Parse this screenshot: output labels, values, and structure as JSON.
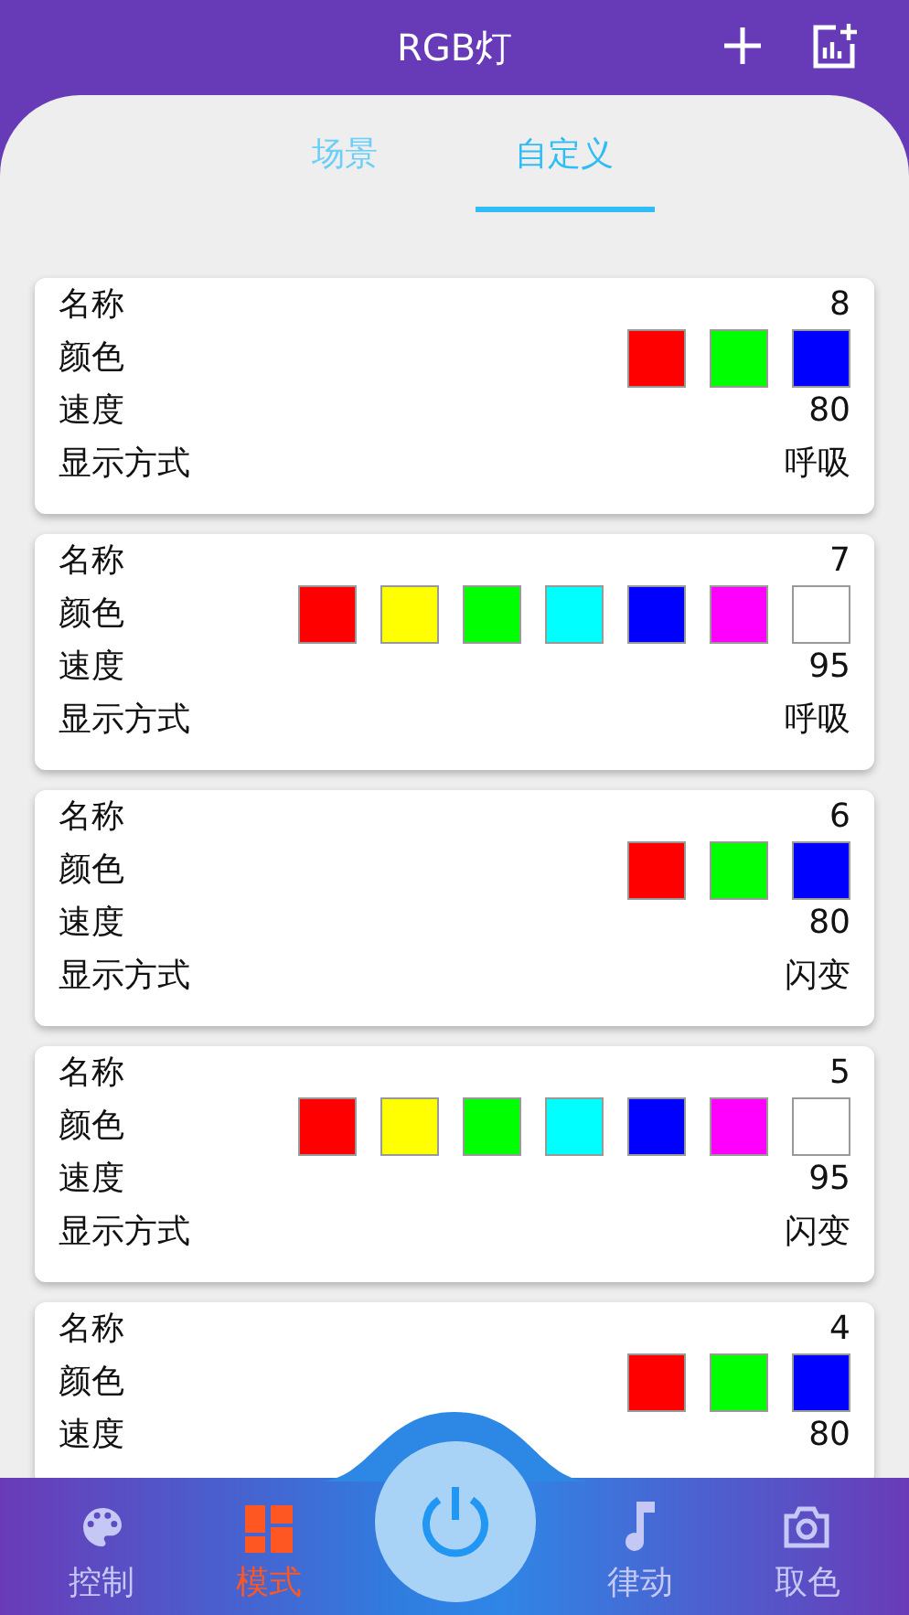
{
  "header": {
    "title": "RGB灯"
  },
  "tabs": [
    {
      "label": "场景",
      "selected": false
    },
    {
      "label": "自定义",
      "selected": true
    }
  ],
  "cards": [
    {
      "fields": [
        {
          "kind": "text",
          "label": "名称",
          "value": "8"
        },
        {
          "kind": "colors",
          "label": "颜色",
          "colors": [
            {
              "color": "#ff0000"
            },
            {
              "color": "#00ff00"
            },
            {
              "color": "#0000ff"
            }
          ]
        },
        {
          "kind": "text",
          "label": "速度",
          "value": "80"
        },
        {
          "kind": "text",
          "label": "显示方式",
          "value": "呼吸"
        }
      ]
    },
    {
      "fields": [
        {
          "kind": "text",
          "label": "名称",
          "value": "7"
        },
        {
          "kind": "colors",
          "label": "颜色",
          "colors": [
            {
              "color": "#ff0000"
            },
            {
              "color": "#ffff00"
            },
            {
              "color": "#00ff00"
            },
            {
              "color": "#00ffff"
            },
            {
              "color": "#0000ff"
            },
            {
              "color": "#ff00ff"
            },
            {
              "color": "#ffffff"
            }
          ]
        },
        {
          "kind": "text",
          "label": "速度",
          "value": "95"
        },
        {
          "kind": "text",
          "label": "显示方式",
          "value": "呼吸"
        }
      ]
    },
    {
      "fields": [
        {
          "kind": "text",
          "label": "名称",
          "value": "6"
        },
        {
          "kind": "colors",
          "label": "颜色",
          "colors": [
            {
              "color": "#ff0000"
            },
            {
              "color": "#00ff00"
            },
            {
              "color": "#0000ff"
            }
          ]
        },
        {
          "kind": "text",
          "label": "速度",
          "value": "80"
        },
        {
          "kind": "text",
          "label": "显示方式",
          "value": "闪变"
        }
      ]
    },
    {
      "fields": [
        {
          "kind": "text",
          "label": "名称",
          "value": "5"
        },
        {
          "kind": "colors",
          "label": "颜色",
          "colors": [
            {
              "color": "#ff0000"
            },
            {
              "color": "#ffff00"
            },
            {
              "color": "#00ff00"
            },
            {
              "color": "#00ffff"
            },
            {
              "color": "#0000ff"
            },
            {
              "color": "#ff00ff"
            },
            {
              "color": "#ffffff"
            }
          ]
        },
        {
          "kind": "text",
          "label": "速度",
          "value": "95"
        },
        {
          "kind": "text",
          "label": "显示方式",
          "value": "闪变"
        }
      ]
    },
    {
      "fields": [
        {
          "kind": "text",
          "label": "名称",
          "value": "4"
        },
        {
          "kind": "colors",
          "label": "颜色",
          "colors": [
            {
              "color": "#ff0000"
            },
            {
              "color": "#00ff00"
            },
            {
              "color": "#0000ff"
            }
          ]
        },
        {
          "kind": "text",
          "label": "速度",
          "value": "80"
        }
      ]
    }
  ],
  "nav": [
    {
      "kind": "palette",
      "label": "控制",
      "selected": false
    },
    {
      "kind": "grid",
      "label": "模式",
      "selected": true
    },
    {
      "kind": "power"
    },
    {
      "kind": "music",
      "label": "律动",
      "selected": false
    },
    {
      "kind": "camera",
      "label": "取色",
      "selected": false
    }
  ]
}
